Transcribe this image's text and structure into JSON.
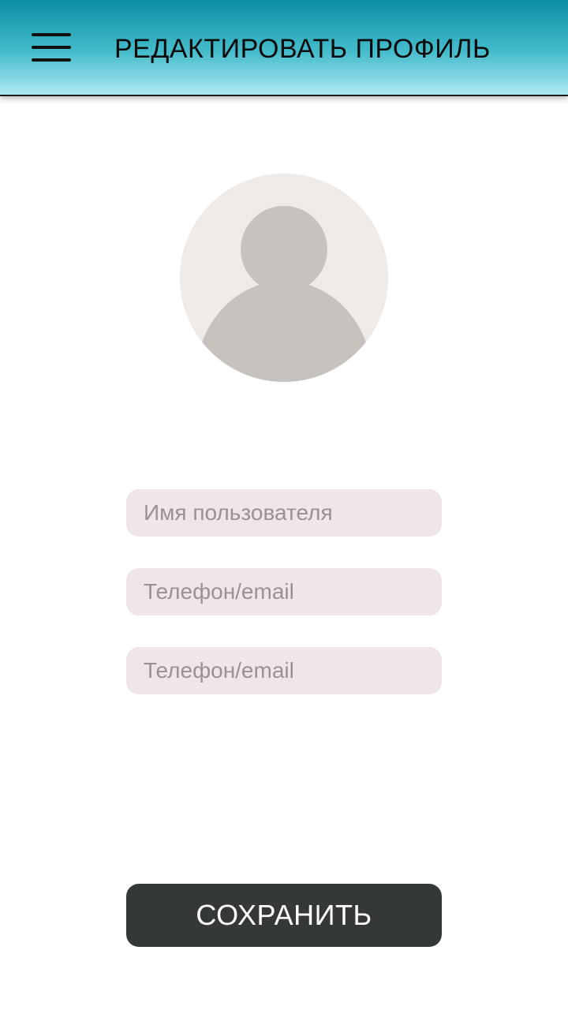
{
  "app_bar": {
    "title": "РЕДАКТИРОВАТЬ ПРОФИЛЬ",
    "menu_icon": "hamburger-menu-icon",
    "gradient_colors": [
      "#0a8fa2",
      "#aee9f1"
    ]
  },
  "avatar": {
    "icon": "default-user-avatar-icon",
    "background_color": "#efebe8",
    "silhouette_color": "#c6c3bf"
  },
  "form": {
    "fields": [
      {
        "placeholder": "Имя пользователя",
        "value": ""
      },
      {
        "placeholder": "Телефон/email",
        "value": ""
      },
      {
        "placeholder": "Телефон/email",
        "value": ""
      }
    ],
    "field_background": "#f1e6e7"
  },
  "save_button": {
    "label": "СОХРАНИТЬ",
    "background": "#353839"
  }
}
